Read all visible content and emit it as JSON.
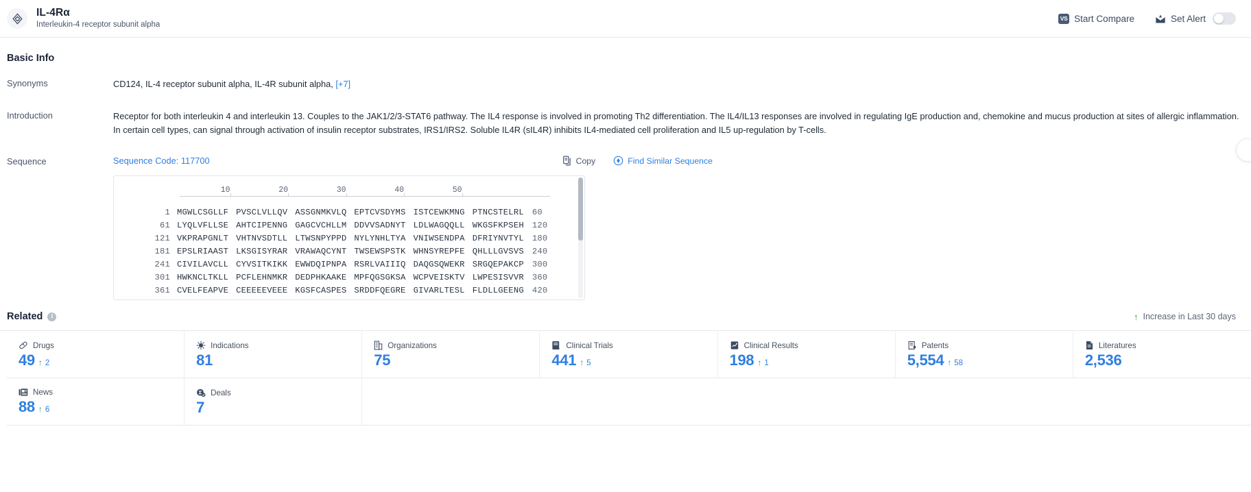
{
  "header": {
    "title": "IL-4Rα",
    "subtitle": "Interleukin-4 receptor subunit alpha",
    "brand_icon": "target-crosshair-icon",
    "start_compare_label": "Start Compare",
    "start_compare_badge": "VS",
    "set_alert_label": "Set Alert",
    "alert_toggle_state": "off"
  },
  "basic_info": {
    "section_title": "Basic Info",
    "synonyms_label": "Synonyms",
    "synonyms_value": "CD124,  IL-4 receptor subunit alpha,  IL-4R subunit alpha,",
    "synonyms_more": "[+7]",
    "introduction_label": "Introduction",
    "introduction_value": "Receptor for both interleukin 4 and interleukin 13. Couples to the JAK1/2/3-STAT6 pathway. The IL4 response is involved in promoting Th2 differentiation. The IL4/IL13 responses are involved in regulating IgE production and, chemokine and mucus production at sites of allergic inflammation. In certain cell types, can signal through activation of insulin receptor substrates, IRS1/IRS2. Soluble IL4R (sIL4R) inhibits IL4-mediated cell proliferation and IL5 up-regulation by T-cells."
  },
  "sequence": {
    "label": "Sequence",
    "code_text": "Sequence Code: 117700",
    "copy_label": "Copy",
    "copy_icon": "copy-icon",
    "find_similar_label": "Find Similar Sequence",
    "find_similar_icon": "find-similar-icon",
    "ruler": [
      "10",
      "20",
      "30",
      "40",
      "50"
    ],
    "rows": [
      {
        "start": "1",
        "chunks": [
          "MGWLCSGLLF",
          "PVSCLVLLQV",
          "ASSGNMKVLQ",
          "EPTCVSDYMS",
          "ISTCEWKMNG",
          "PTNCSTELRL"
        ],
        "end": "60"
      },
      {
        "start": "61",
        "chunks": [
          "LYQLVFLLSE",
          "AHTCIPENNG",
          "GAGCVCHLLM",
          "DDVVSADNYT",
          "LDLWAGQQLL",
          "WKGSFKPSEH"
        ],
        "end": "120"
      },
      {
        "start": "121",
        "chunks": [
          "VKPRAPGNLT",
          "VHTNVSDTLL",
          "LTWSNPYPPD",
          "NYLYNHLTYA",
          "VNIWSENDPA",
          "DFRIYNVTYL"
        ],
        "end": "180"
      },
      {
        "start": "181",
        "chunks": [
          "EPSLRIAAST",
          "LKSGISYRAR",
          "VRAWAQCYNT",
          "TWSEWSPSTK",
          "WHNSYREPFE",
          "QHLLLGVSVS"
        ],
        "end": "240"
      },
      {
        "start": "241",
        "chunks": [
          "CIVILAVCLL",
          "CYVSITKIKK",
          "EWWDQIPNPA",
          "RSRLVAIIIQ",
          "DAQGSQWEKR",
          "SRGQEPAKCP"
        ],
        "end": "300"
      },
      {
        "start": "301",
        "chunks": [
          "HWKNCLTKLL",
          "PCFLEHNMKR",
          "DEDPHKAAKE",
          "MPFQGSGKSA",
          "WCPVEISKTV",
          "LWPESISVVR"
        ],
        "end": "360"
      },
      {
        "start": "361",
        "chunks": [
          "CVELFEAPVE",
          "CEEEEEVEEE",
          "KGSFCASPES",
          "SRDDFQEGRE",
          "GIVARLTESL",
          "FLDLLGEENG"
        ],
        "end": "420"
      }
    ]
  },
  "related": {
    "title": "Related",
    "info_icon": "info-icon",
    "increase_note": "Increase in Last 30 days",
    "increase_arrow_color": "#2e9e40",
    "cards": [
      {
        "name": "Drugs",
        "icon": "capsule-icon",
        "value": "49",
        "delta": "2"
      },
      {
        "name": "Indications",
        "icon": "virus-icon",
        "value": "81",
        "delta": ""
      },
      {
        "name": "Organizations",
        "icon": "building-icon",
        "value": "75",
        "delta": ""
      },
      {
        "name": "Clinical Trials",
        "icon": "clinical-trial-icon",
        "value": "441",
        "delta": "5"
      },
      {
        "name": "Clinical Results",
        "icon": "clinical-result-icon",
        "value": "198",
        "delta": "1"
      },
      {
        "name": "Patents",
        "icon": "patent-icon",
        "value": "5,554",
        "delta": "58"
      },
      {
        "name": "Literatures",
        "icon": "literature-icon",
        "value": "2,536",
        "delta": ""
      },
      {
        "name": "News",
        "icon": "news-icon",
        "value": "88",
        "delta": "6"
      },
      {
        "name": "Deals",
        "icon": "deals-icon",
        "value": "7",
        "delta": ""
      }
    ]
  },
  "colors": {
    "accent_blue": "#2f7fe0",
    "green": "#2e9e40",
    "text_dark": "#1b2437",
    "text_muted": "#4a5568"
  }
}
